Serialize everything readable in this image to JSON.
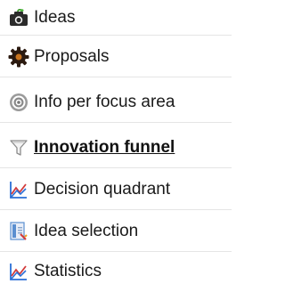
{
  "menu": {
    "items": [
      {
        "label": "Ideas",
        "icon": "camera-icon",
        "active": false
      },
      {
        "label": "Proposals",
        "icon": "gear-icon",
        "active": false
      },
      {
        "label": "Info per focus area",
        "icon": "target-icon",
        "active": false
      },
      {
        "label": "Innovation funnel",
        "icon": "funnel-icon",
        "active": true
      },
      {
        "label": "Decision quadrant",
        "icon": "chart-icon",
        "active": false
      },
      {
        "label": "Idea selection",
        "icon": "document-icon",
        "active": false
      },
      {
        "label": "Statistics",
        "icon": "chart-icon",
        "active": false
      }
    ]
  },
  "colors": {
    "text": "#1a1a1a",
    "separator": "#e5e5e5",
    "gear": "#2b1a10",
    "chart_blue": "#2a6fd6",
    "chart_red": "#d23a3a",
    "document_blue": "#5a8fd0"
  }
}
